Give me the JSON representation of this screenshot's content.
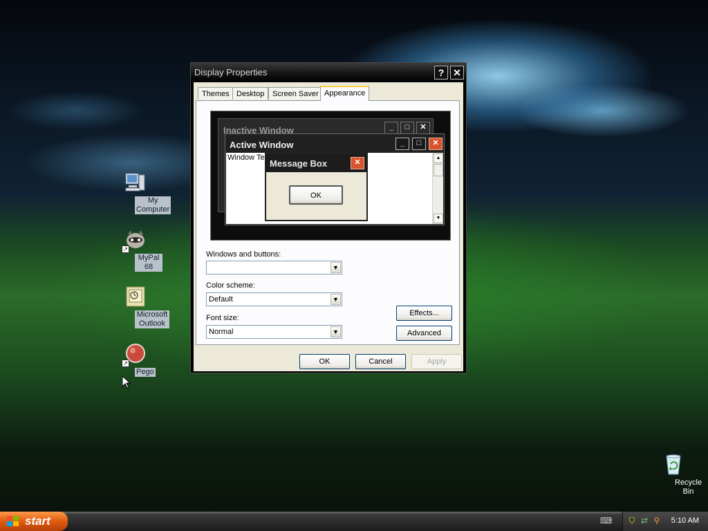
{
  "desktop": {
    "icons": [
      {
        "label": "My Computer"
      },
      {
        "label": "MyPal 68"
      },
      {
        "label": "Microsoft Outlook"
      },
      {
        "label": "Pego"
      },
      {
        "label": "Recycle Bin"
      }
    ]
  },
  "window": {
    "title": "Display Properties",
    "help_glyph": "?",
    "close_glyph": "✕",
    "tabs": [
      {
        "label": "Themes"
      },
      {
        "label": "Desktop"
      },
      {
        "label": "Screen Saver"
      },
      {
        "label": "Appearance",
        "active": true
      }
    ],
    "preview": {
      "inactive_title": "Inactive Window",
      "active_title": "Active Window",
      "window_text": "Window Text",
      "message_title": "Message Box",
      "message_ok": "OK"
    },
    "fields": {
      "windows_buttons_label": "Windows and buttons:",
      "windows_buttons_value": "",
      "color_scheme_label": "Color scheme:",
      "color_scheme_value": "Default",
      "font_size_label": "Font size:",
      "font_size_value": "Normal"
    },
    "buttons": {
      "effects": "Effects...",
      "advanced": "Advanced",
      "ok": "OK",
      "cancel": "Cancel",
      "apply": "Apply"
    }
  },
  "taskbar": {
    "start_label": "start",
    "clock": "5:10 AM"
  },
  "colors": {
    "start_orange": "#e05b10",
    "tab_highlight": "#ffc83c",
    "close_red": "#d9532e"
  }
}
